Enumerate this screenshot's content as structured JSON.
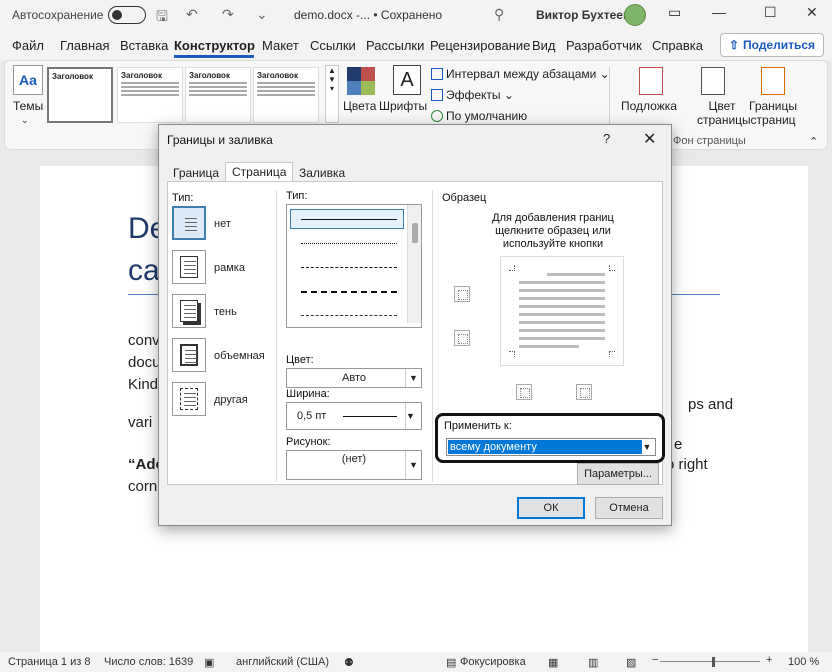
{
  "titlebar": {
    "autosave_label": "Автосохранение",
    "doc_title": "demo.docx -...  •  Сохранено",
    "user_name": "Виктор Бухтеев"
  },
  "ribbon_tabs": [
    "Файл",
    "Главная",
    "Вставка",
    "Конструктор",
    "Макет",
    "Ссылки",
    "Рассылки",
    "Рецензирование",
    "Вид",
    "Разработчик",
    "Справка"
  ],
  "share_label": "Поделиться",
  "ribbon": {
    "themes": "Темы",
    "gallery_title_1": "Заголовок",
    "gallery_title_2": "Заголовок",
    "gallery_title_3": "Заголовок",
    "gallery_title_4": "Заголовок",
    "colors": "Цвета",
    "fonts": "Шрифты",
    "paragraph_spacing": "Интервал между абзацами",
    "effects": "Эффекты",
    "set_default": "По умолчанию",
    "watermark": "Подложка",
    "page_color": "Цвет страницы",
    "page_borders": "Границы страниц",
    "page_background_group": "Фон страницы"
  },
  "document": {
    "heading_1": "De",
    "heading_2": "ca",
    "line_1": "conv",
    "line_2": "docu",
    "line_3": "Kind",
    "line_4": "vari",
    "line_4_right": "ps and",
    "line_5": "“Ado",
    "line_5_right": "e",
    "line_5b_right": "o right",
    "line_6": "corn"
  },
  "status": {
    "page": "Страница 1 из 8",
    "words": "Число слов: 1639",
    "language": "английский (США)",
    "focus": "Фокусировка",
    "zoom": "100 %"
  },
  "dialog": {
    "title": "Границы и заливка",
    "help": "?",
    "close": "✕",
    "tabs": [
      "Граница",
      "Страница",
      "Заливка"
    ],
    "active_tab": 1,
    "type_label": "Тип:",
    "settings": [
      "нет",
      "рамка",
      "тень",
      "объемная",
      "другая"
    ],
    "style_label": "Тип:",
    "color_label": "Цвет:",
    "color_value": "Авто",
    "width_label": "Ширина:",
    "width_value": "0,5 пт",
    "art_label": "Рисунок:",
    "art_value": "(нет)",
    "preview_label": "Образец",
    "preview_hint": "Для добавления границ щелкните образец или используйте кнопки",
    "apply_label": "Применить к:",
    "apply_value": "всему документу",
    "options_button": "Параметры...",
    "ok_button": "ОК",
    "cancel_button": "Отмена"
  }
}
